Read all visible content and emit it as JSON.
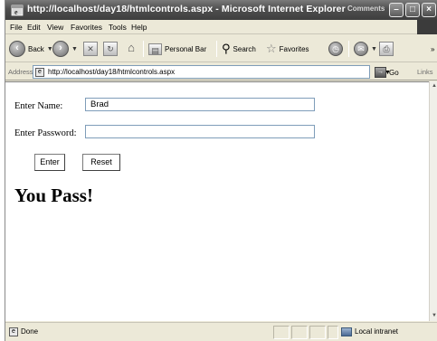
{
  "window": {
    "title": "http://localhost/day18/htmlcontrols.aspx - Microsoft Internet Explorer",
    "comments_label": "Comments",
    "minimize": "–",
    "maximize": "□",
    "close": "×"
  },
  "menu": {
    "items": [
      "File",
      "Edit",
      "View",
      "Favorites",
      "Tools",
      "Help"
    ]
  },
  "toolbar": {
    "back_label": "Back",
    "search_label": "Search",
    "favorites_label": "Favorites",
    "personal_bar_label": "Personal Bar"
  },
  "address": {
    "label": "Address",
    "url": "http://localhost/day18/htmlcontrols.aspx",
    "go_label": "Go",
    "links_label": "Links"
  },
  "form": {
    "name_label": "Enter Name:",
    "name_value": "Brad",
    "password_label": "Enter Password:",
    "password_value": "",
    "enter_button": "Enter",
    "reset_button": "Reset",
    "result_text": "You Pass!"
  },
  "status": {
    "text": "Done",
    "zone": "Local intranet"
  }
}
